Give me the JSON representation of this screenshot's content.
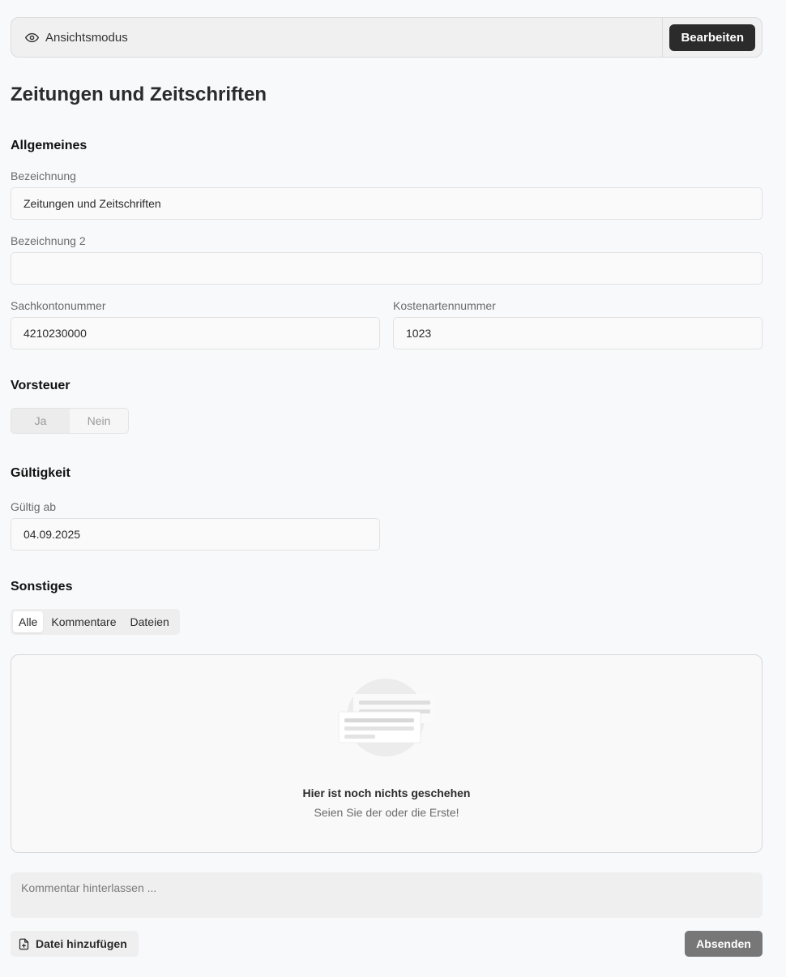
{
  "modebar": {
    "mode_label": "Ansichtsmodus",
    "edit_label": "Bearbeiten"
  },
  "page_title": "Zeitungen und Zeitschriften",
  "sections": {
    "general": {
      "title": "Allgemeines",
      "name_label": "Bezeichnung",
      "name_value": "Zeitungen und Zeitschriften",
      "name2_label": "Bezeichnung 2",
      "name2_value": "",
      "account_label": "Sachkontonummer",
      "account_value": "4210230000",
      "cost_type_label": "Kostenartennummer",
      "cost_type_value": "1023"
    },
    "input_tax": {
      "title": "Vorsteuer",
      "options": [
        "Ja",
        "Nein"
      ],
      "selected": "Ja"
    },
    "validity": {
      "title": "Gültigkeit",
      "valid_from_label": "Gültig ab",
      "valid_from_value": "04.09.2025"
    },
    "misc": {
      "title": "Sonstiges",
      "tabs": [
        "Alle",
        "Kommentare",
        "Dateien"
      ],
      "active_tab": "Alle",
      "empty_title": "Hier ist noch nichts geschehen",
      "empty_subtitle": "Seien Sie der oder die Erste!"
    }
  },
  "comment": {
    "placeholder": "Kommentar hinterlassen ...",
    "value": ""
  },
  "actions": {
    "add_file_label": "Datei hinzufügen",
    "send_label": "Absenden"
  },
  "icons": {
    "mode": "eye-icon",
    "add_file": "file-plus-icon",
    "empty": "empty-messages-illustration"
  },
  "colors": {
    "primary_button": "#2b2b2b",
    "disabled_button": "#777777",
    "background": "#f8f9fa"
  }
}
